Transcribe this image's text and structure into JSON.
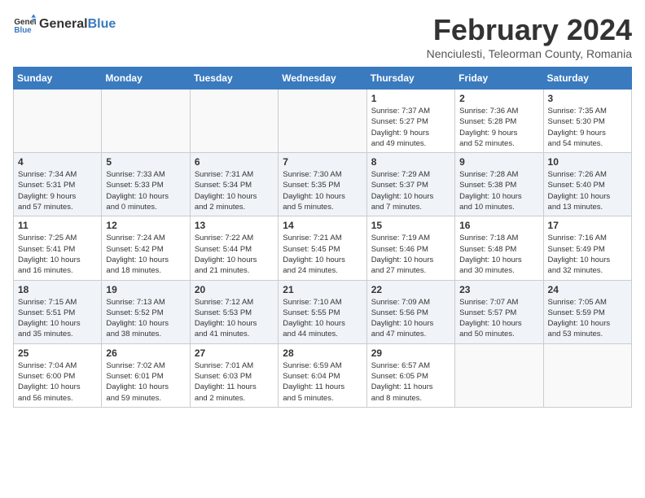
{
  "header": {
    "logo": {
      "general": "General",
      "blue": "Blue"
    },
    "title": "February 2024",
    "subtitle": "Nenciulesti, Teleorman County, Romania"
  },
  "calendar": {
    "days_of_week": [
      "Sunday",
      "Monday",
      "Tuesday",
      "Wednesday",
      "Thursday",
      "Friday",
      "Saturday"
    ],
    "weeks": [
      {
        "cells": [
          {
            "empty": true
          },
          {
            "empty": true
          },
          {
            "empty": true
          },
          {
            "empty": true
          },
          {
            "day": 1,
            "info": "Sunrise: 7:37 AM\nSunset: 5:27 PM\nDaylight: 9 hours\nand 49 minutes."
          },
          {
            "day": 2,
            "info": "Sunrise: 7:36 AM\nSunset: 5:28 PM\nDaylight: 9 hours\nand 52 minutes."
          },
          {
            "day": 3,
            "info": "Sunrise: 7:35 AM\nSunset: 5:30 PM\nDaylight: 9 hours\nand 54 minutes."
          }
        ]
      },
      {
        "cells": [
          {
            "day": 4,
            "info": "Sunrise: 7:34 AM\nSunset: 5:31 PM\nDaylight: 9 hours\nand 57 minutes."
          },
          {
            "day": 5,
            "info": "Sunrise: 7:33 AM\nSunset: 5:33 PM\nDaylight: 10 hours\nand 0 minutes."
          },
          {
            "day": 6,
            "info": "Sunrise: 7:31 AM\nSunset: 5:34 PM\nDaylight: 10 hours\nand 2 minutes."
          },
          {
            "day": 7,
            "info": "Sunrise: 7:30 AM\nSunset: 5:35 PM\nDaylight: 10 hours\nand 5 minutes."
          },
          {
            "day": 8,
            "info": "Sunrise: 7:29 AM\nSunset: 5:37 PM\nDaylight: 10 hours\nand 7 minutes."
          },
          {
            "day": 9,
            "info": "Sunrise: 7:28 AM\nSunset: 5:38 PM\nDaylight: 10 hours\nand 10 minutes."
          },
          {
            "day": 10,
            "info": "Sunrise: 7:26 AM\nSunset: 5:40 PM\nDaylight: 10 hours\nand 13 minutes."
          }
        ]
      },
      {
        "cells": [
          {
            "day": 11,
            "info": "Sunrise: 7:25 AM\nSunset: 5:41 PM\nDaylight: 10 hours\nand 16 minutes."
          },
          {
            "day": 12,
            "info": "Sunrise: 7:24 AM\nSunset: 5:42 PM\nDaylight: 10 hours\nand 18 minutes."
          },
          {
            "day": 13,
            "info": "Sunrise: 7:22 AM\nSunset: 5:44 PM\nDaylight: 10 hours\nand 21 minutes."
          },
          {
            "day": 14,
            "info": "Sunrise: 7:21 AM\nSunset: 5:45 PM\nDaylight: 10 hours\nand 24 minutes."
          },
          {
            "day": 15,
            "info": "Sunrise: 7:19 AM\nSunset: 5:46 PM\nDaylight: 10 hours\nand 27 minutes."
          },
          {
            "day": 16,
            "info": "Sunrise: 7:18 AM\nSunset: 5:48 PM\nDaylight: 10 hours\nand 30 minutes."
          },
          {
            "day": 17,
            "info": "Sunrise: 7:16 AM\nSunset: 5:49 PM\nDaylight: 10 hours\nand 32 minutes."
          }
        ]
      },
      {
        "cells": [
          {
            "day": 18,
            "info": "Sunrise: 7:15 AM\nSunset: 5:51 PM\nDaylight: 10 hours\nand 35 minutes."
          },
          {
            "day": 19,
            "info": "Sunrise: 7:13 AM\nSunset: 5:52 PM\nDaylight: 10 hours\nand 38 minutes."
          },
          {
            "day": 20,
            "info": "Sunrise: 7:12 AM\nSunset: 5:53 PM\nDaylight: 10 hours\nand 41 minutes."
          },
          {
            "day": 21,
            "info": "Sunrise: 7:10 AM\nSunset: 5:55 PM\nDaylight: 10 hours\nand 44 minutes."
          },
          {
            "day": 22,
            "info": "Sunrise: 7:09 AM\nSunset: 5:56 PM\nDaylight: 10 hours\nand 47 minutes."
          },
          {
            "day": 23,
            "info": "Sunrise: 7:07 AM\nSunset: 5:57 PM\nDaylight: 10 hours\nand 50 minutes."
          },
          {
            "day": 24,
            "info": "Sunrise: 7:05 AM\nSunset: 5:59 PM\nDaylight: 10 hours\nand 53 minutes."
          }
        ]
      },
      {
        "cells": [
          {
            "day": 25,
            "info": "Sunrise: 7:04 AM\nSunset: 6:00 PM\nDaylight: 10 hours\nand 56 minutes."
          },
          {
            "day": 26,
            "info": "Sunrise: 7:02 AM\nSunset: 6:01 PM\nDaylight: 10 hours\nand 59 minutes."
          },
          {
            "day": 27,
            "info": "Sunrise: 7:01 AM\nSunset: 6:03 PM\nDaylight: 11 hours\nand 2 minutes."
          },
          {
            "day": 28,
            "info": "Sunrise: 6:59 AM\nSunset: 6:04 PM\nDaylight: 11 hours\nand 5 minutes."
          },
          {
            "day": 29,
            "info": "Sunrise: 6:57 AM\nSunset: 6:05 PM\nDaylight: 11 hours\nand 8 minutes."
          },
          {
            "empty": true
          },
          {
            "empty": true
          }
        ]
      }
    ]
  }
}
